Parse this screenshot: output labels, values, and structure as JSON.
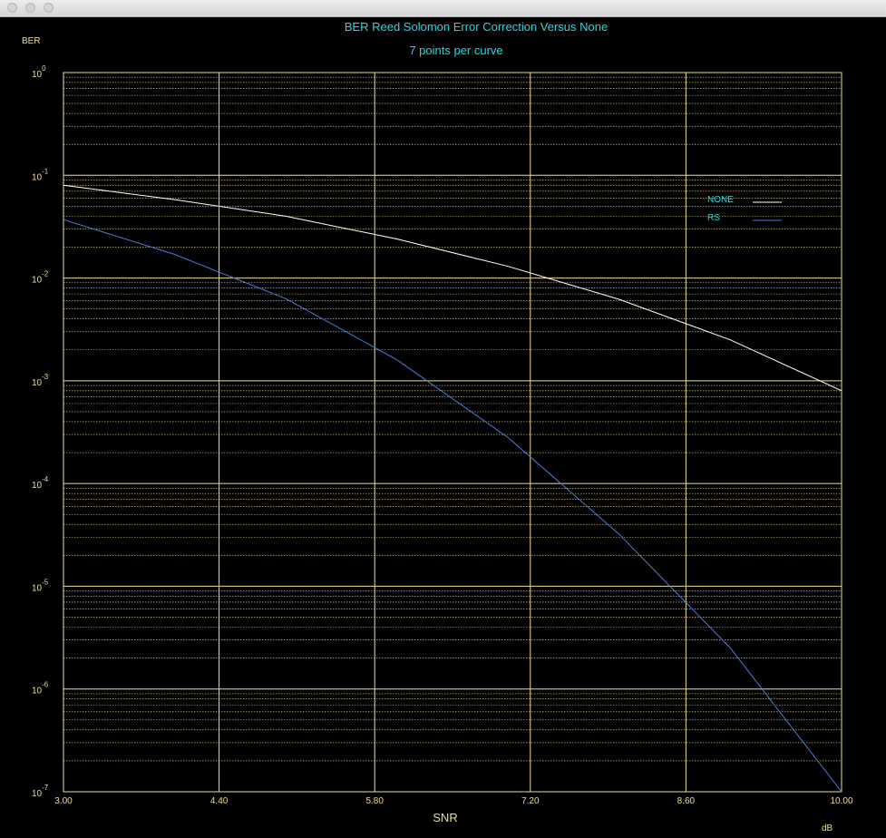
{
  "window": {
    "controls": [
      "close",
      "minimize",
      "zoom"
    ]
  },
  "colors": {
    "background": "#000000",
    "axis": "#f0df8a",
    "grid": "#f0df8a",
    "title": "#2ad8e0",
    "series_none": "#ffffff",
    "series_rs": "#4a7fe0"
  },
  "chart_data": {
    "type": "line",
    "title": "BER Reed Solomon Error Correction Versus None",
    "subtitle": "7 points per curve",
    "ylabel": "BER",
    "xlabel": "SNR",
    "xunit": "dB",
    "xlim": [
      3.0,
      10.0
    ],
    "ylim": [
      1e-07,
      1
    ],
    "yscale": "log",
    "grid": true,
    "legend_position": "top-right",
    "x_ticks": [
      "3.00",
      "4.40",
      "5.80",
      "7.20",
      "8.60",
      "10.00"
    ],
    "x_tick_values": [
      3.0,
      4.4,
      5.8,
      7.2,
      8.6,
      10.0
    ],
    "y_ticks": [
      {
        "base": "10",
        "exp": "0",
        "value": 1
      },
      {
        "base": "10",
        "exp": "-1",
        "value": 0.1
      },
      {
        "base": "10",
        "exp": "-2",
        "value": 0.01
      },
      {
        "base": "10",
        "exp": "-3",
        "value": 0.001
      },
      {
        "base": "10",
        "exp": "-4",
        "value": 0.0001
      },
      {
        "base": "10",
        "exp": "-5",
        "value": 1e-05
      },
      {
        "base": "10",
        "exp": "-6",
        "value": 1e-06
      },
      {
        "base": "10",
        "exp": "-7",
        "value": 1e-07
      }
    ],
    "series": [
      {
        "name": "NONE",
        "color": "#ffffff",
        "x": [
          3.0,
          4.0,
          5.0,
          6.0,
          7.0,
          8.0,
          9.0,
          10.0
        ],
        "y": [
          0.08,
          0.058,
          0.04,
          0.024,
          0.013,
          0.0062,
          0.0025,
          0.0008
        ]
      },
      {
        "name": "RS",
        "color": "#4a7fe0",
        "x": [
          3.0,
          4.0,
          5.0,
          6.0,
          7.0,
          8.0,
          9.0,
          10.0
        ],
        "y": [
          0.037,
          0.017,
          0.0063,
          0.0016,
          0.00028,
          3.2e-05,
          2.5e-06,
          1e-07
        ]
      }
    ]
  }
}
